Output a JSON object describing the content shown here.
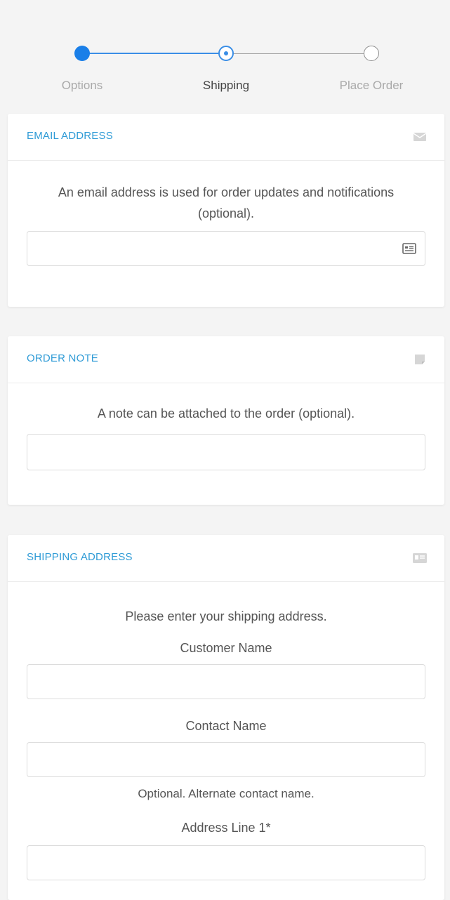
{
  "stepper": {
    "steps": [
      {
        "label": "Options",
        "state": "completed"
      },
      {
        "label": "Shipping",
        "state": "current"
      },
      {
        "label": "Place Order",
        "state": "pending"
      }
    ]
  },
  "email_card": {
    "title": "EMAIL ADDRESS",
    "icon": "envelope-icon",
    "description": "An email address is used for order updates and notifications (optional).",
    "input": {
      "value": "",
      "placeholder": "",
      "icon": "address-card-icon"
    }
  },
  "note_card": {
    "title": "ORDER NOTE",
    "icon": "sticky-note-icon",
    "description": "A note can be attached to the order (optional).",
    "input": {
      "value": "",
      "placeholder": ""
    }
  },
  "shipping_card": {
    "title": "SHIPPING ADDRESS",
    "icon": "id-card-icon",
    "description": "Please enter your shipping address.",
    "fields": {
      "customer_name": {
        "label": "Customer Name",
        "value": ""
      },
      "contact_name": {
        "label": "Contact Name",
        "value": "",
        "note": "Optional. Alternate contact name."
      },
      "address_line_1": {
        "label": "Address Line 1*",
        "value": ""
      }
    }
  },
  "colors": {
    "accent": "#2f9bd6",
    "step_active": "#1a7fe8",
    "background": "#f4f4f4"
  }
}
